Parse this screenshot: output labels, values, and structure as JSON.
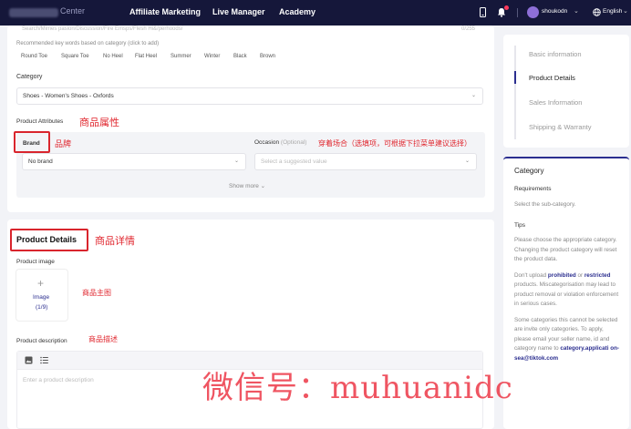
{
  "nav": {
    "brand_partial": "Center",
    "items": [
      "Affiliate Marketing",
      "Live Manager",
      "Academy"
    ],
    "user": "shoukodn",
    "language": "English"
  },
  "top_partial": {
    "input_overflow": "Search/Mimes pasion/Discussion/Fire Emsps/Flesh Hi&/perhoods/",
    "counter": "0/255"
  },
  "keywords": {
    "hint": "Recommended key words based on category (click to add)",
    "chips": [
      "Round Toe",
      "Square Toe",
      "No Heel",
      "Flat Heel",
      "Summer",
      "Winter",
      "Black",
      "Brown"
    ]
  },
  "category": {
    "label": "Category",
    "value": "Shoes - Women's Shoes - Oxfords"
  },
  "attributes": {
    "label": "Product Attributes",
    "label_cn": "商品属性",
    "brand_label": "Brand",
    "brand_cn": "品牌",
    "brand_value": "No brand",
    "occasion_label": "Occasion",
    "occasion_optional": "(Optional)",
    "occasion_cn": "穿着场合（选填项，可根据下拉菜单建议选择）",
    "occasion_placeholder": "Select a suggested value",
    "show_more": "Show more"
  },
  "details": {
    "title": "Product Details",
    "title_cn": "商品详情",
    "image_label": "Product image",
    "image_upload": "Image",
    "image_count": "(1/9)",
    "image_cn": "商品主图",
    "desc_label": "Product description",
    "desc_cn": "商品描述",
    "desc_placeholder": "Enter a product description"
  },
  "steps": [
    "Basic information",
    "Product Details",
    "Sales Information",
    "Shipping & Warranty"
  ],
  "help": {
    "title": "Category",
    "req_title": "Requirements",
    "req_text": "Select the sub-category.",
    "tips_title": "Tips",
    "tip1": "Please choose the appropriate category. Changing the product category will reset the product data.",
    "tip2_pre": "Don't upload",
    "tip2_prohibited": "prohibited",
    "tip2_or": "or",
    "tip2_restricted": "restricted",
    "tip2_post": "products. Miscategorisation may lead to product removal or violation enforcement in serious cases.",
    "tip3_a": "Some categories this cannot be selected are invite only categories. To apply, please email your seller name, id",
    "tip3_b": "and category name to",
    "tip3_email": "category.applicati on-sea@tiktok.com"
  },
  "watermark": "微信号：muhuanidc",
  "colors": {
    "nav_bg": "#15173a",
    "accent": "#2b2e8f",
    "annotation_red": "#e0262e"
  }
}
